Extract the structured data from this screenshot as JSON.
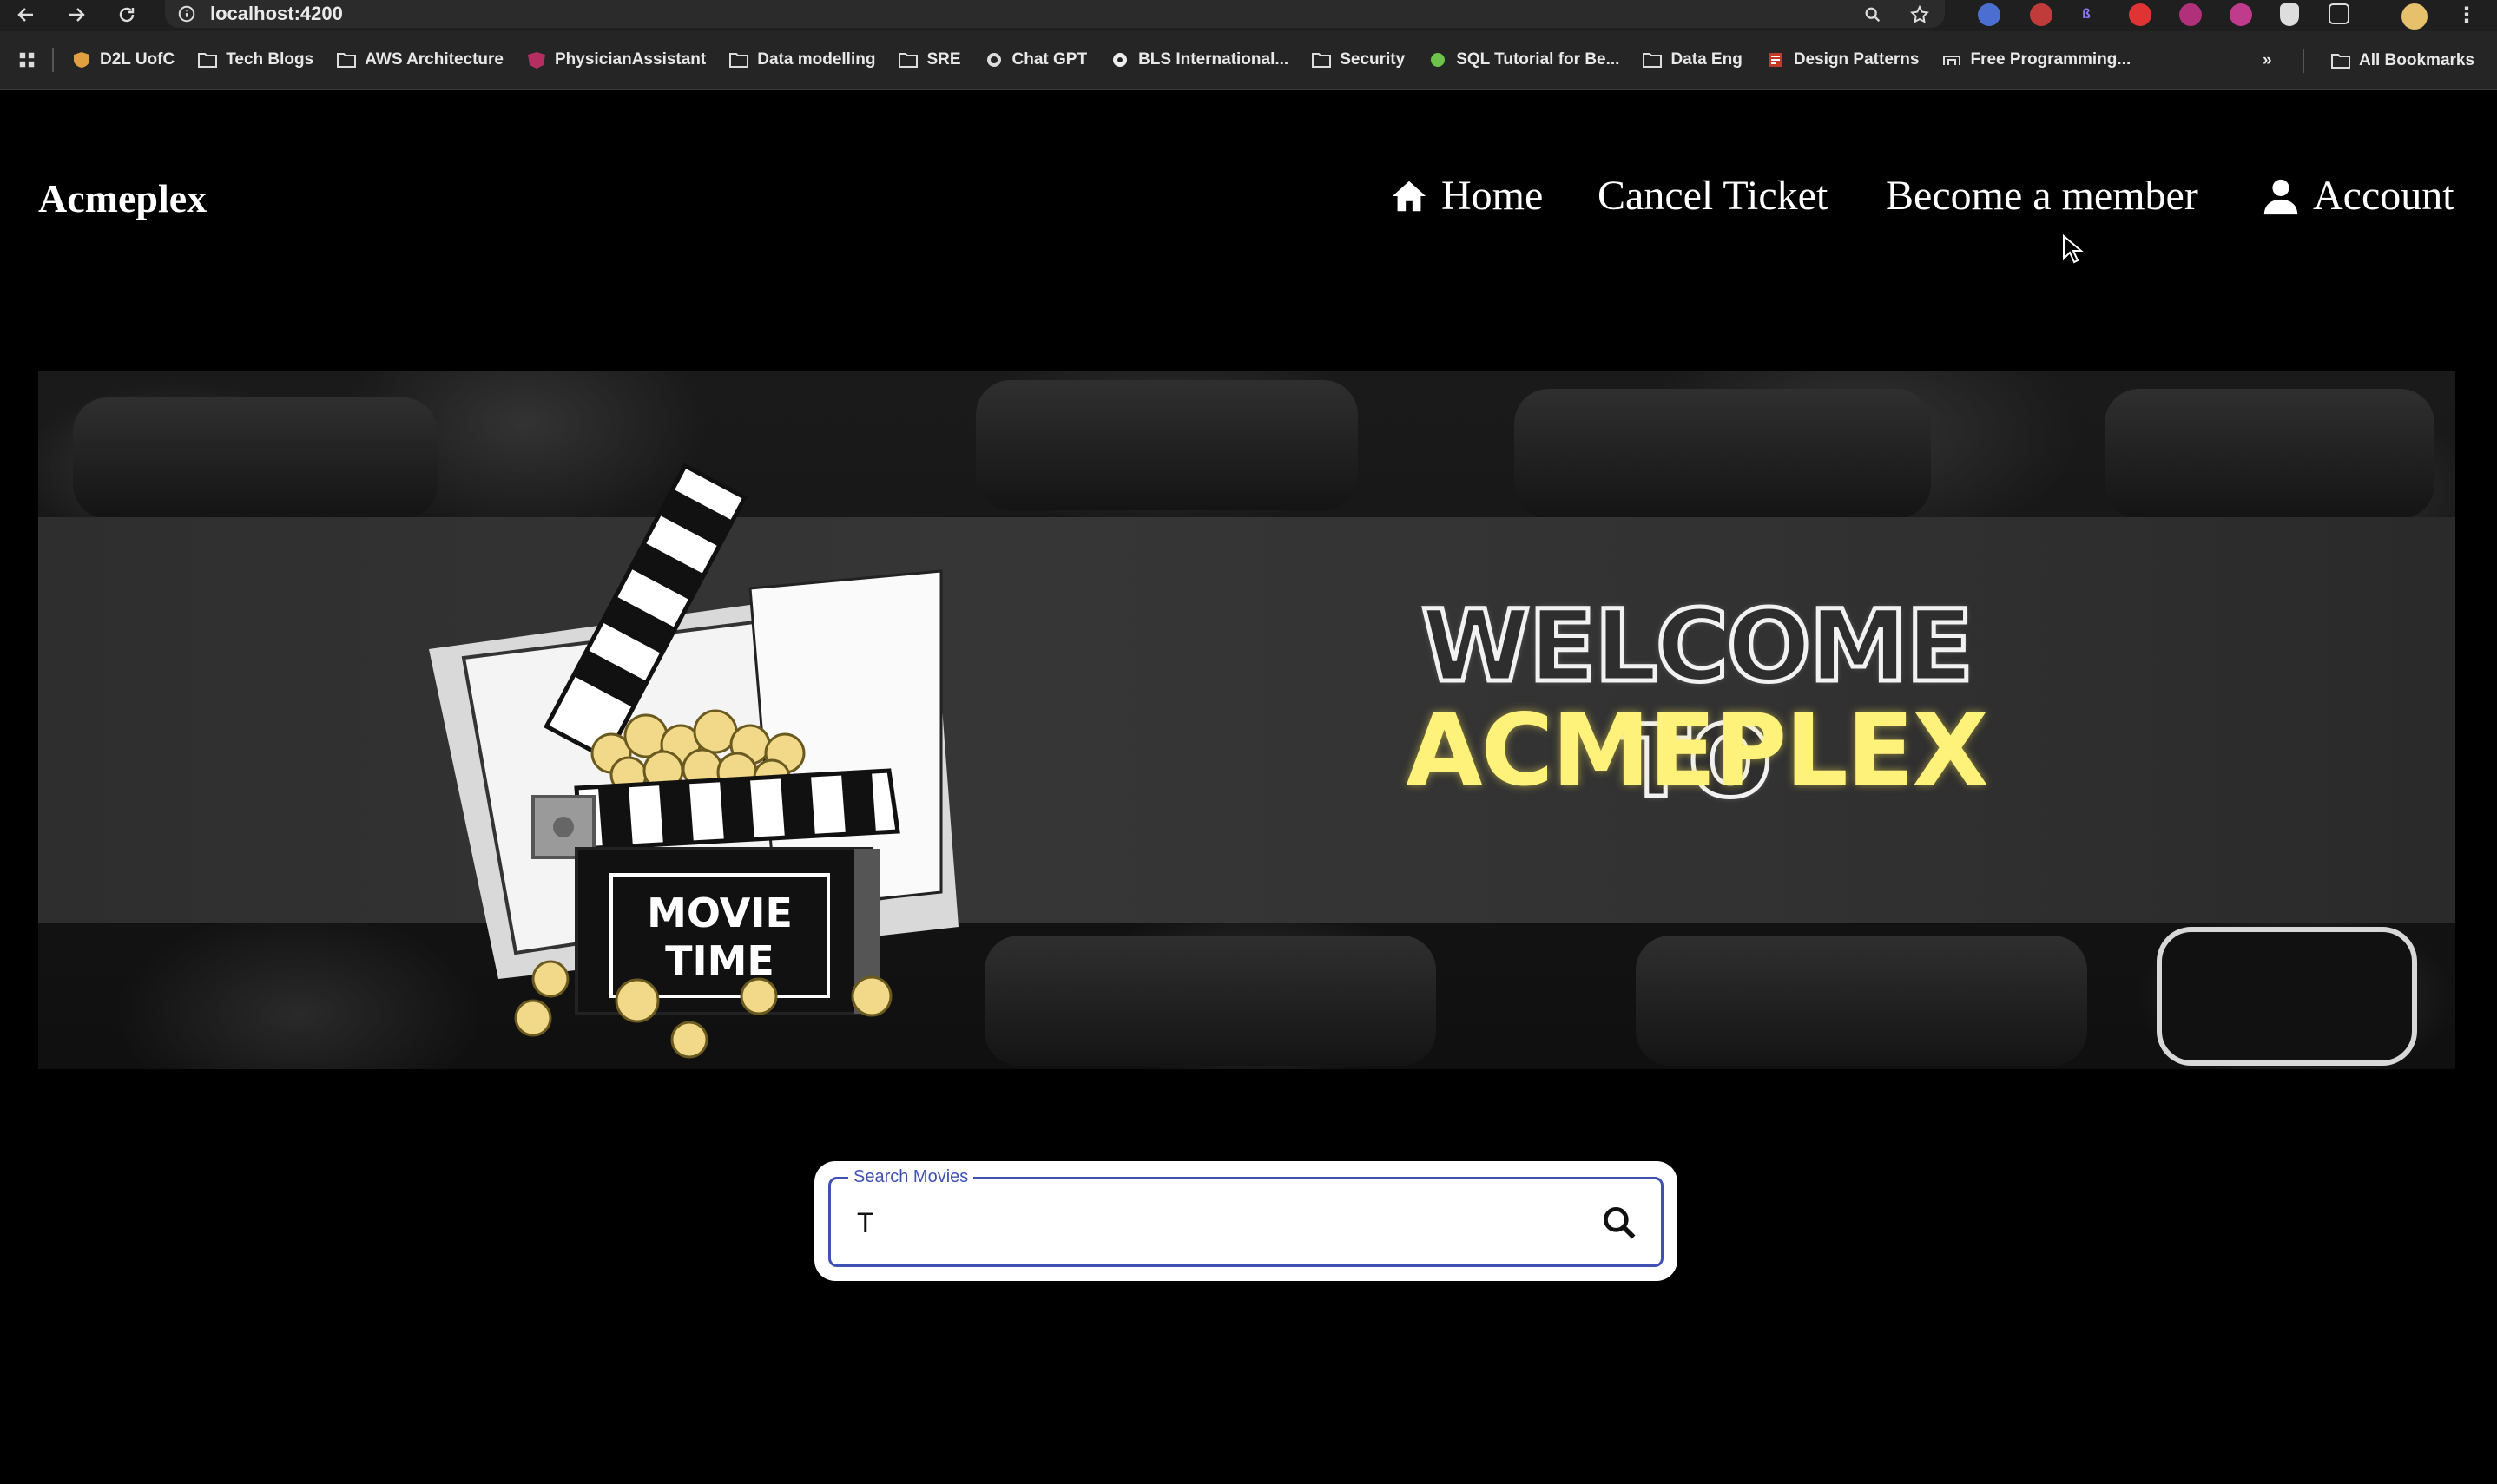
{
  "browser": {
    "url": "localhost:4200",
    "bookmarks": [
      {
        "label": "D2L UofC",
        "icon": "shield-icon"
      },
      {
        "label": "Tech Blogs",
        "icon": "folder-icon"
      },
      {
        "label": "AWS Architecture",
        "icon": "folder-icon"
      },
      {
        "label": "PhysicianAssistant",
        "icon": "angular-icon"
      },
      {
        "label": "Data modelling",
        "icon": "folder-icon"
      },
      {
        "label": "SRE",
        "icon": "folder-icon"
      },
      {
        "label": "Chat GPT",
        "icon": "openai-icon"
      },
      {
        "label": "BLS International...",
        "icon": "globe-icon"
      },
      {
        "label": "Security",
        "icon": "folder-icon"
      },
      {
        "label": "SQL Tutorial for Be...",
        "icon": "green-dot-icon"
      },
      {
        "label": "Data Eng",
        "icon": "folder-icon"
      },
      {
        "label": "Design Patterns",
        "icon": "pattern-icon"
      },
      {
        "label": "Free Programming...",
        "icon": "link-icon"
      }
    ],
    "more_label": "»",
    "all_bookmarks_label": "All Bookmarks"
  },
  "header": {
    "brand": "Acmeplex",
    "nav": {
      "home": "Home",
      "cancel_ticket": "Cancel Ticket",
      "become_member": "Become a member",
      "account": "Account"
    }
  },
  "hero": {
    "line1": "WELCOME TO",
    "line2": "ACMEPLEX",
    "clapper_text_1": "MOVIE",
    "clapper_text_2": "TIME"
  },
  "search": {
    "label": "Search Movies",
    "value": "T"
  },
  "colors": {
    "background": "#000000",
    "accent_yellow": "#fff27a",
    "field_border": "#3f51b5"
  }
}
